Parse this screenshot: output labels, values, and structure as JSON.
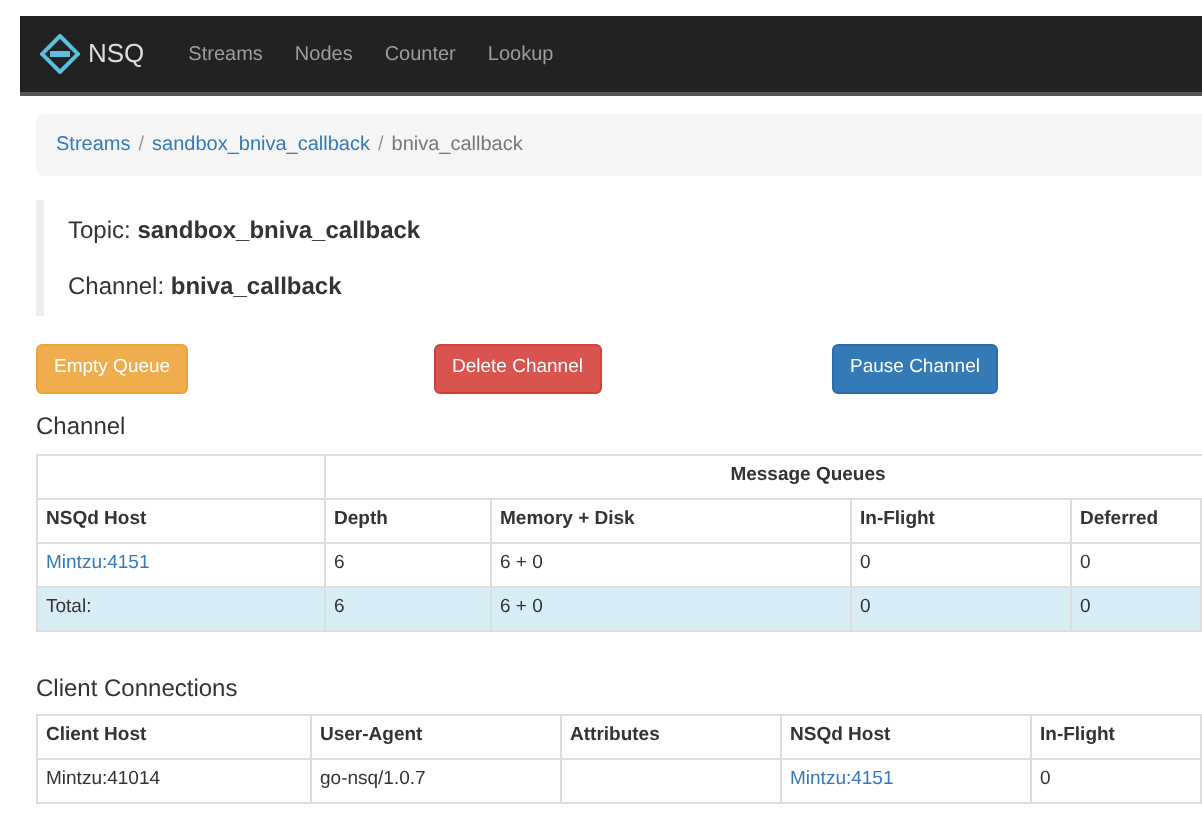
{
  "navbar": {
    "brand": "NSQ",
    "links": [
      "Streams",
      "Nodes",
      "Counter",
      "Lookup"
    ]
  },
  "breadcrumb": [
    {
      "text": "Streams",
      "kind": "link"
    },
    {
      "text": "/",
      "kind": "separator"
    },
    {
      "text": "sandbox_bniva_callback",
      "kind": "link"
    },
    {
      "text": "/",
      "kind": "separator"
    },
    {
      "text": "bniva_callback",
      "kind": "current"
    }
  ],
  "info": [
    {
      "label": "Topic:",
      "value": "sandbox_bniva_callback"
    },
    {
      "label": "Channel:",
      "value": "bniva_callback"
    }
  ],
  "buttons": [
    {
      "label": "Empty Queue",
      "kind": "warning"
    },
    {
      "label": "Delete Channel",
      "kind": "danger"
    },
    {
      "label": "Pause Channel",
      "kind": "primary"
    }
  ],
  "channel_section": {
    "title": "Channel",
    "group_header": "Message Queues",
    "columns": [
      "NSQd Host",
      "Depth",
      "Memory + Disk",
      "In-Flight",
      "Deferred"
    ],
    "rows": [
      {
        "highlighted": false,
        "cells": [
          {
            "text": "Mintzu:4151",
            "kind": "link"
          },
          {
            "text": "6",
            "kind": "text"
          },
          {
            "text": "6 + 0",
            "kind": "text"
          },
          {
            "text": "0",
            "kind": "text"
          },
          {
            "text": "0",
            "kind": "text"
          }
        ]
      },
      {
        "highlighted": true,
        "cells": [
          {
            "text": "Total:",
            "kind": "text"
          },
          {
            "text": "6",
            "kind": "text"
          },
          {
            "text": "6 + 0",
            "kind": "text"
          },
          {
            "text": "0",
            "kind": "text"
          },
          {
            "text": "0",
            "kind": "text"
          }
        ]
      }
    ]
  },
  "clients_section": {
    "title": "Client Connections",
    "columns": [
      "Client Host",
      "User-Agent",
      "Attributes",
      "NSQd Host",
      "In-Flight"
    ],
    "rows": [
      {
        "highlighted": false,
        "cells": [
          {
            "text": "Mintzu:41014",
            "kind": "text"
          },
          {
            "text": "go-nsq/1.0.7",
            "kind": "text"
          },
          {
            "kind": "empty"
          },
          {
            "text": "Mintzu:4151",
            "kind": "link"
          },
          {
            "text": "0",
            "kind": "text"
          }
        ]
      }
    ]
  }
}
